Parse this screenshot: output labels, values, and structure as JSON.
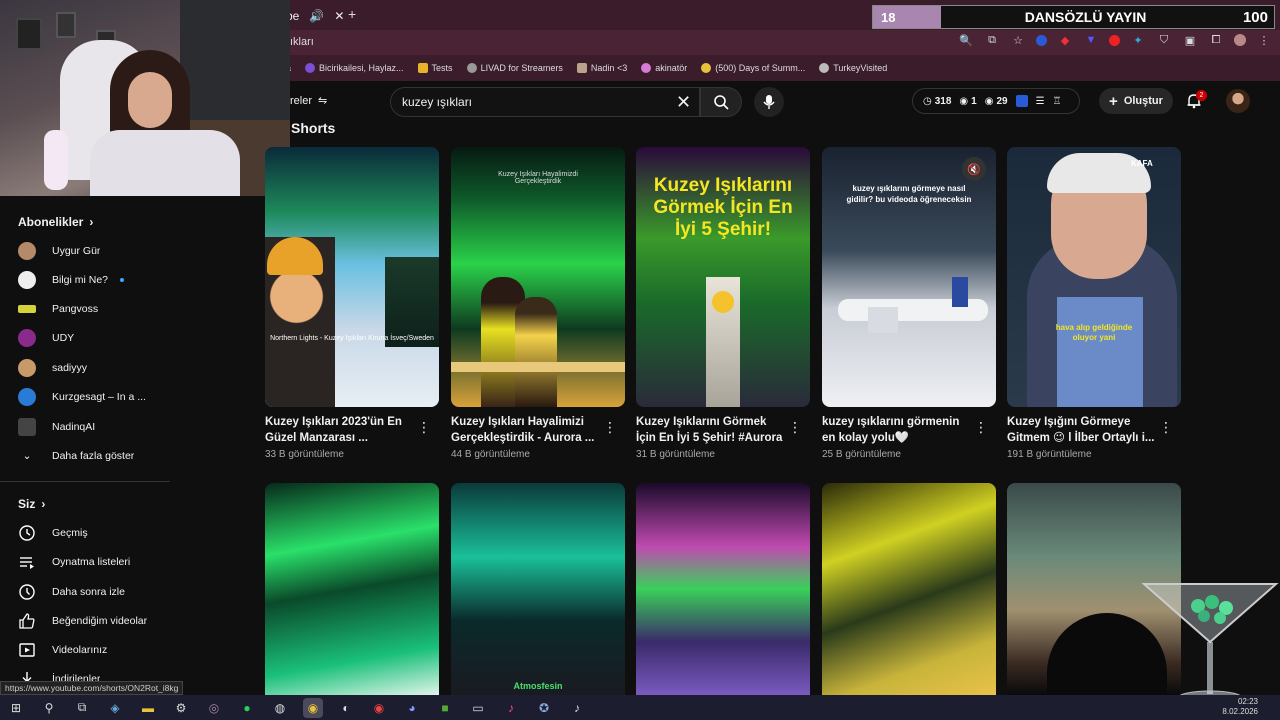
{
  "browser": {
    "tab_label": "be",
    "url_fragment": "ıkları",
    "bookmarks": [
      {
        "label": "a",
        "color": "#888"
      },
      {
        "label": "Bicirikailesi, Haylaz...",
        "color": "#7b4fd6"
      },
      {
        "label": "Tests",
        "color": "#e8b22a"
      },
      {
        "label": "LIVAD for Streamers",
        "color": "#999"
      },
      {
        "label": "Nadin <3",
        "color": "#b9a38a"
      },
      {
        "label": "akinatör",
        "color": "#d67bd6"
      },
      {
        "label": "(500) Days of Summ...",
        "color": "#e6c23a"
      },
      {
        "label": "TurkeyVisited",
        "color": "#bbb"
      }
    ]
  },
  "overlay": {
    "count": "18",
    "title": "DANSÖZLÜ YAYIN",
    "score": "100"
  },
  "youtube": {
    "filters_label": "reler",
    "search": {
      "value": "kuzey ışıkları"
    },
    "stats": {
      "a": "318",
      "b": "1",
      "c": "29"
    },
    "create_label": "Oluştur",
    "notif_count": "2"
  },
  "sidebar": {
    "subs_header": "Abonelikler",
    "subs": [
      {
        "label": "Uygur Gür",
        "color": "#b38a6a"
      },
      {
        "label": "Bilgi mi Ne?",
        "color": "#eeeeee",
        "dot": true
      },
      {
        "label": "Pangvoss",
        "color": "#d6d23a"
      },
      {
        "label": "UDY",
        "color": "#8a2a8a"
      },
      {
        "label": "sadiyyy",
        "color": "#c79a6a"
      },
      {
        "label": "Kurzgesagt – In a ...",
        "color": "#2a7bd6"
      },
      {
        "label": "NadinqAI",
        "color": "#444"
      }
    ],
    "show_more": "Daha fazla göster",
    "you_header": "Siz",
    "you_items": [
      {
        "label": "Geçmiş",
        "icon": "history-icon"
      },
      {
        "label": "Oynatma listeleri",
        "icon": "playlist-icon"
      },
      {
        "label": "Daha sonra izle",
        "icon": "watch-later-icon"
      },
      {
        "label": "Beğendiğim videolar",
        "icon": "like-icon"
      },
      {
        "label": "Videolarınız",
        "icon": "your-videos-icon"
      },
      {
        "label": "İndirilenler",
        "icon": "download-icon"
      }
    ]
  },
  "shorts": {
    "title": "Shorts",
    "row1": [
      {
        "title": "Kuzey Işıkları 2023'ün En Güzel Manzarası ...",
        "views": "33 B görüntüleme",
        "thumb_text": "Northern Lights - Kuzey Işıkları Kiruna İsveç/Sweden"
      },
      {
        "title": "Kuzey Işıkları Hayalimizi Gerçekleştirdik - Aurora ...",
        "views": "44 B görüntüleme",
        "thumb_text": "Kuzey Işıkları Hayalimizdi Gerçekleştirdik"
      },
      {
        "title": "Kuzey Işıklarını Görmek İçin En İyi 5 Şehir! #Aurora",
        "views": "31 B görüntüleme",
        "thumb_text": "Kuzey Işıklarını Görmek İçin En İyi 5 Şehir!"
      },
      {
        "title": "kuzey ışıklarını görmenin en kolay yolu🤍",
        "views": "25 B görüntüleme",
        "thumb_text": "kuzey ışıklarını görmeye nasıl gidilir? bu videoda öğreneceksin"
      },
      {
        "title": "Kuzey Işığını Görmeye Gitmem 😉 l İlber Ortaylı i...",
        "views": "191 B görüntüleme",
        "thumb_text": "hava alıp geldiğinde oluyor yani"
      }
    ],
    "row1_logo": "KAFA",
    "row2_caption": "Atmosfesin"
  },
  "status_url": "https://www.youtube.com/shorts/ON2Rot_i8kg",
  "clock": {
    "time": "02:23",
    "date": "8.02.2026"
  }
}
